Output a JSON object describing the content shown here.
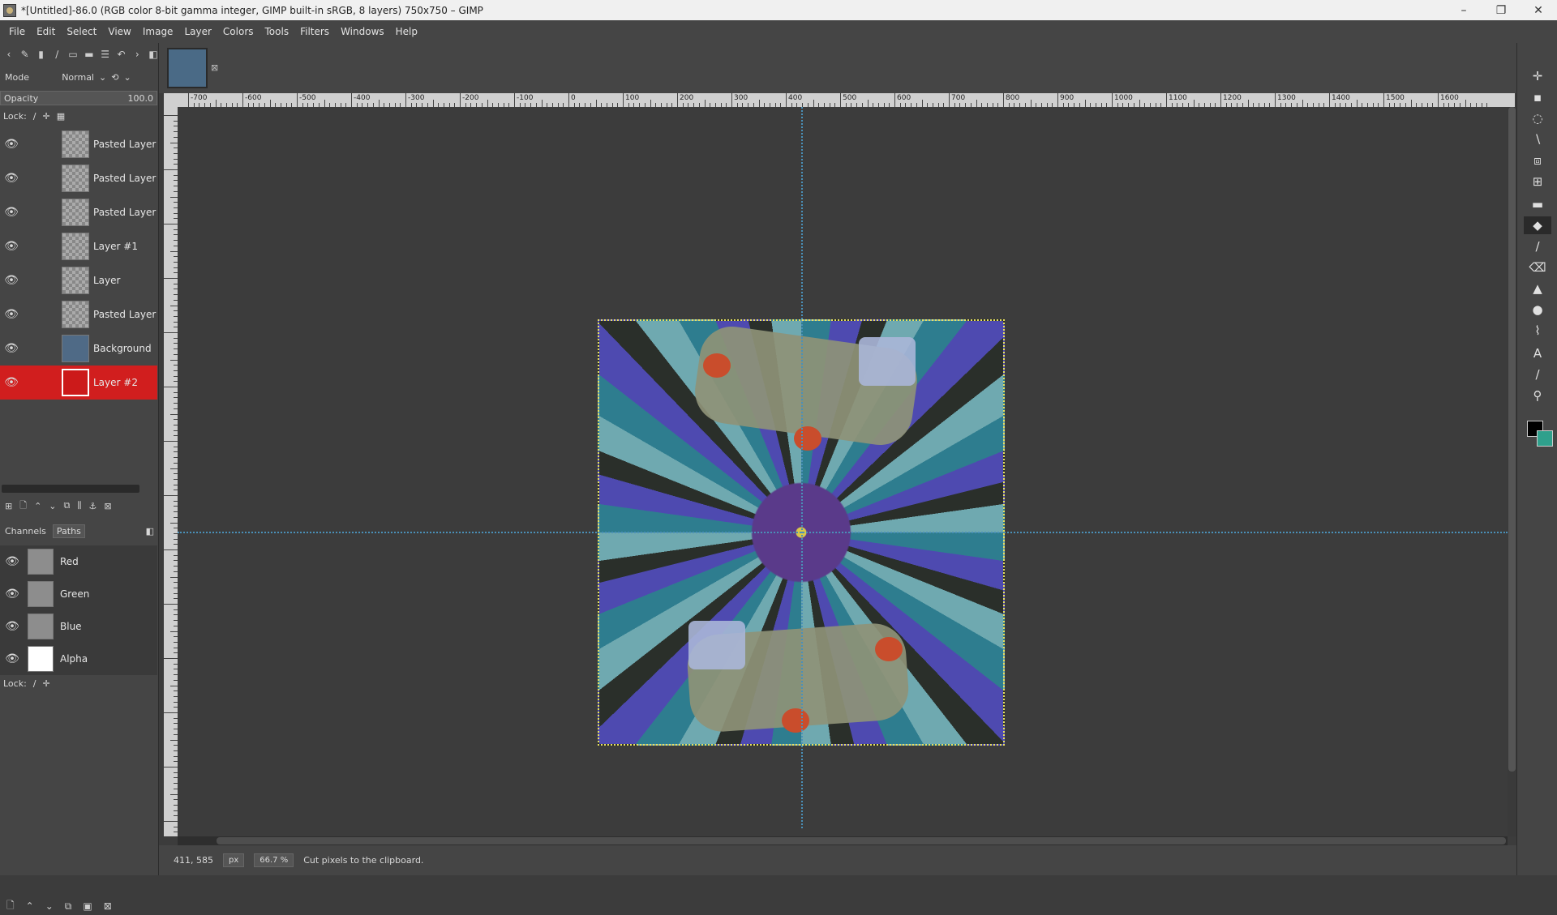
{
  "window": {
    "title": "*[Untitled]-86.0 (RGB color 8-bit gamma integer, GIMP built-in sRGB, 8 layers) 750x750 – GIMP",
    "controls": [
      "–",
      "❐",
      "✕"
    ]
  },
  "menubar": [
    "File",
    "Edit",
    "Select",
    "View",
    "Image",
    "Layer",
    "Colors",
    "Tools",
    "Filters",
    "Windows",
    "Help"
  ],
  "layers_panel": {
    "mode_label": "Mode",
    "mode_value": "Normal",
    "opacity_label": "Opacity",
    "opacity_value": "100.0",
    "lock_label": "Lock:",
    "layers": [
      {
        "name": "Pasted Layer",
        "visible": true,
        "active": false
      },
      {
        "name": "Pasted Layer",
        "visible": true,
        "active": false
      },
      {
        "name": "Pasted Layer",
        "visible": true,
        "active": false
      },
      {
        "name": "Layer #1",
        "visible": true,
        "active": false
      },
      {
        "name": "Layer",
        "visible": true,
        "active": false
      },
      {
        "name": "Pasted Layer",
        "visible": true,
        "active": false
      },
      {
        "name": "Background",
        "visible": true,
        "active": false
      },
      {
        "name": "Layer #2",
        "visible": true,
        "active": true
      }
    ]
  },
  "channels_panel": {
    "tabs": [
      "Channels",
      "Paths"
    ],
    "channels": [
      "Red",
      "Green",
      "Blue",
      "Alpha"
    ],
    "lock_label": "Lock:"
  },
  "statusbar": {
    "coords": "411, 585",
    "unit": "px",
    "zoom": "66.7 %",
    "message": "Cut pixels to the clipboard."
  },
  "ruler_labels": [
    "-700",
    "-600",
    "-500",
    "-400",
    "-300",
    "-200",
    "-100",
    "0",
    "100",
    "200",
    "300",
    "400",
    "500",
    "600",
    "700",
    "800",
    "900",
    "1000",
    "1100",
    "1200",
    "1300",
    "1400",
    "1500",
    "1600"
  ],
  "colors": {
    "active_layer": "#d11e1e",
    "guide": "#4a90b8",
    "selection": "#e8e060",
    "foreground": "#000000",
    "background": "#2fa08c"
  }
}
